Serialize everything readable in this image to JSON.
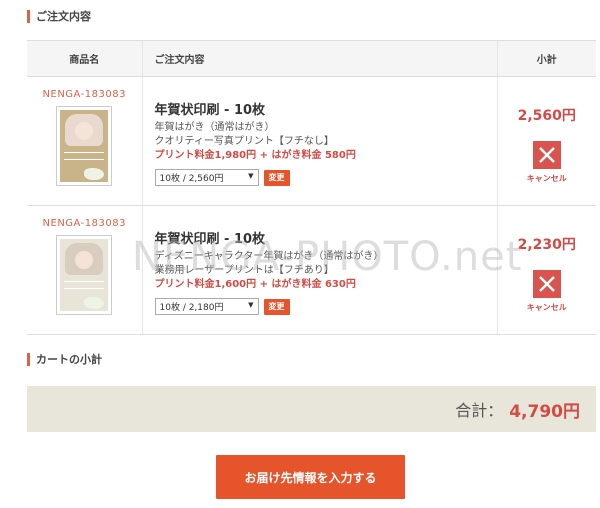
{
  "order_section_title": "ご注文内容",
  "subtotal_section_title": "カートの小計",
  "table_headers": {
    "name": "商品名",
    "detail": "ご注文内容",
    "subtotal": "小計"
  },
  "items": [
    {
      "code": "NENGA-183083",
      "title": "年賀状印刷 - 10枚",
      "line1": "年賀はがき（通常はがき）",
      "line2": "クオリティー写真プリント【フチなし】",
      "price_line": "プリント料金1,980円 + はがき料金 580円",
      "qty_selected": "10枚 / 2,560円",
      "change_label": "変更",
      "subtotal": "2,560円",
      "cancel_label": "キャンセル"
    },
    {
      "code": "NENGA-183083",
      "title": "年賀状印刷 - 10枚",
      "line1": "ディズニーキャラクター年賀はがき（通常はがき）",
      "line2": "業務用レーザープリントは【フチあり】",
      "price_line": "プリント料金1,600円 + はがき料金 630円",
      "qty_selected": "10枚 / 2,180円",
      "change_label": "変更",
      "subtotal": "2,230円",
      "cancel_label": "キャンセル"
    }
  ],
  "total_label": "合計：",
  "total_value": "4,790円",
  "cta_label": "お届け先情報を入力する",
  "watermark": "NENGA-PHOTO.net",
  "colors": {
    "accent": "#e6542c",
    "price": "#d24b45",
    "cancel": "#d9534f",
    "total_bar": "#e8e6da"
  }
}
